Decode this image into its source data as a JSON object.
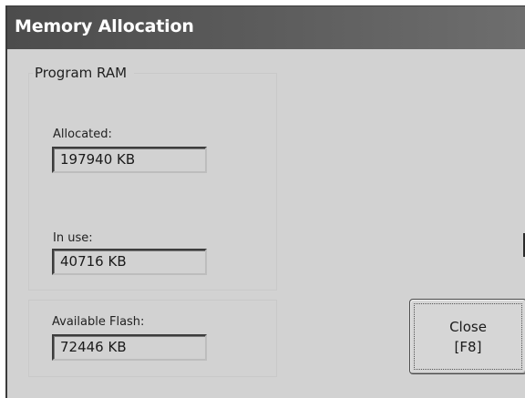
{
  "window": {
    "title": "Memory Allocation"
  },
  "program_ram": {
    "caption": "Program RAM",
    "allocated": {
      "label": "Allocated:",
      "value": "197940 KB"
    },
    "in_use": {
      "label": "In use:",
      "value": "40716 KB"
    }
  },
  "flash": {
    "label": "Available Flash:",
    "value": "72446 KB"
  },
  "close_button": {
    "label": "Close",
    "shortcut": "[F8]"
  },
  "colors": {
    "titlebar": "#555555",
    "window_background": "#d2d2d2",
    "title_text": "#ffffff"
  }
}
